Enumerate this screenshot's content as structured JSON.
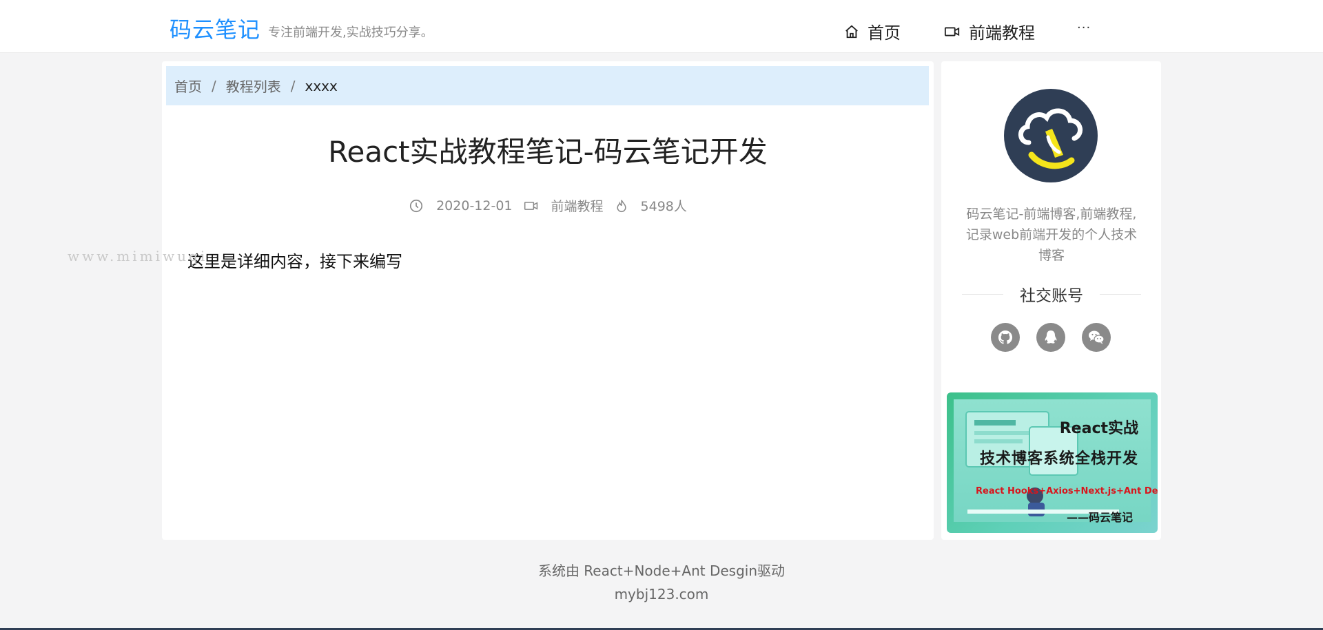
{
  "header": {
    "logo": "码云笔记",
    "slogan": "专注前端开发,实战技巧分享。",
    "nav": [
      {
        "label": "首页",
        "icon": "home-icon"
      },
      {
        "label": "前端教程",
        "icon": "video-icon"
      }
    ],
    "more": "···"
  },
  "breadcrumb": {
    "items": [
      "首页",
      "教程列表",
      "xxxx"
    ],
    "separator": "/"
  },
  "article": {
    "title": "React实战教程笔记-码云笔记开发",
    "date": "2020-12-01",
    "category": "前端教程",
    "views": "5498人",
    "content": "这里是详细内容，接下来编写"
  },
  "watermark": "www.mimiwuqi",
  "sidebar": {
    "author_desc": "码云笔记-前端博客,前端教程,记录web前端开发的个人技术博客",
    "social_title": "社交账号",
    "socials": [
      "github-icon",
      "qq-icon",
      "wechat-icon"
    ],
    "banner": {
      "line1": "React实战",
      "line2": "技术博客系统全栈开发",
      "line3": "React Hooks+Axios+Next.js+Ant Desgin...",
      "line4": "——码云笔记"
    }
  },
  "footer": {
    "line1": "系统由 React+Node+Ant Desgin驱动",
    "line2": "mybj123.com"
  },
  "colors": {
    "accent": "#1e90ff",
    "breadcrumb_bg": "#ddeefc",
    "page_bg": "#f4f4f5"
  }
}
